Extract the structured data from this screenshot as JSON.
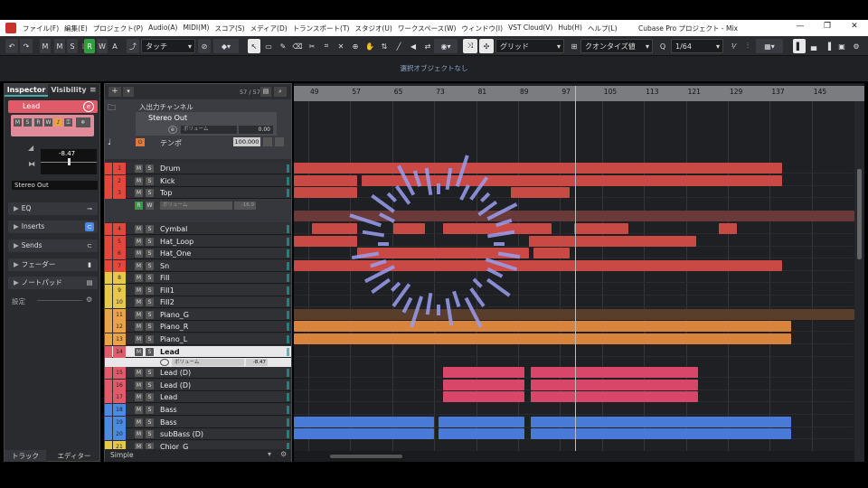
{
  "titlebar": {
    "menus": [
      "ファイル(F)",
      "編集(E)",
      "プロジェクト(P)",
      "Audio(A)",
      "MIDI(M)",
      "スコア(S)",
      "メディア(D)",
      "トランスポート(T)",
      "スタジオ(U)",
      "ワークスペース(W)",
      "ウィンドウ(I)",
      "VST Cloud(V)",
      "Hub(H)",
      "ヘルプ(L)"
    ],
    "title": "Cubase Pro プロジェクト - Mix",
    "minimize": "—",
    "maximize": "❐",
    "close": "✕"
  },
  "toolbar": {
    "undo": "↶",
    "redo": "↷",
    "m": "M",
    "s": "S",
    "l": "L",
    "r": "R",
    "w": "W",
    "a": "A",
    "touch": "タッチ",
    "grid": "グリッド",
    "quantize": "クオンタイズ値",
    "quant_val": "1/64",
    "colors": {
      "r_bg": "#2e9e3e"
    }
  },
  "status": {
    "text": "選択オブジェクトなし"
  },
  "inspector": {
    "tab1": "Inspector",
    "tab2": "Visibility",
    "track_name": "Lead",
    "volume": "-8.47",
    "output": "Stereo Out",
    "sections": [
      "EQ",
      "Inserts",
      "Sends",
      "フェーダー",
      "ノートパッド"
    ],
    "settings": "設定",
    "bottom_tab1": "トラック",
    "bottom_tab2": "エディター",
    "colors": {
      "lead": "#e05a6a"
    }
  },
  "tracklist": {
    "count": "57 / 57",
    "footer": "Simple",
    "io_channel": "入出力チャンネル",
    "stereo_out": "Stereo Out",
    "vol_label": "ボリューム",
    "vol_val": "0.00",
    "tempo_label": "テンポ",
    "tempo_val": "100.000",
    "lead_vol_label": "ボリューム",
    "lead_vol_val": "-8.47",
    "kick_vol_label": "ボリューム",
    "kick_vol_val": "-16.9"
  },
  "tracks": [
    {
      "num": "1",
      "name": "Drum",
      "color": "#e5463c"
    },
    {
      "num": "2",
      "name": "Kick",
      "color": "#e5463c"
    },
    {
      "num": "3",
      "name": "Top",
      "color": "#e5463c"
    },
    {
      "num": "4",
      "name": "Cymbal",
      "color": "#e5463c"
    },
    {
      "num": "5",
      "name": "Hat_Loop",
      "color": "#e5463c"
    },
    {
      "num": "6",
      "name": "Hat_One",
      "color": "#e5463c"
    },
    {
      "num": "7",
      "name": "Sn",
      "color": "#e5463c"
    },
    {
      "num": "8",
      "name": "Fill",
      "color": "#e8c84a"
    },
    {
      "num": "9",
      "name": "Fill1",
      "color": "#e8c84a"
    },
    {
      "num": "10",
      "name": "Fill2",
      "color": "#e8c84a"
    },
    {
      "num": "11",
      "name": "Piano_G",
      "color": "#e9a44a"
    },
    {
      "num": "12",
      "name": "Piano_R",
      "color": "#e9a44a"
    },
    {
      "num": "13",
      "name": "Piano_L",
      "color": "#e9a44a"
    },
    {
      "num": "14",
      "name": "Lead",
      "color": "#e05a6a"
    },
    {
      "num": "15",
      "name": "Lead (D)",
      "color": "#e05a6a"
    },
    {
      "num": "16",
      "name": "Lead (D)",
      "color": "#e05a6a"
    },
    {
      "num": "17",
      "name": "Lead",
      "color": "#e05a6a"
    },
    {
      "num": "18",
      "name": "Bass",
      "color": "#4a8ae0"
    },
    {
      "num": "19",
      "name": "Bass",
      "color": "#4a8ae0"
    },
    {
      "num": "20",
      "name": "subBass (D)",
      "color": "#4a8ae0"
    },
    {
      "num": "21",
      "name": "Chior_G",
      "color": "#e8c84a"
    }
  ],
  "ruler": {
    "bars": [
      "49",
      "57",
      "65",
      "73",
      "81",
      "89",
      "97",
      "105",
      "113",
      "121",
      "129",
      "137",
      "145"
    ]
  }
}
